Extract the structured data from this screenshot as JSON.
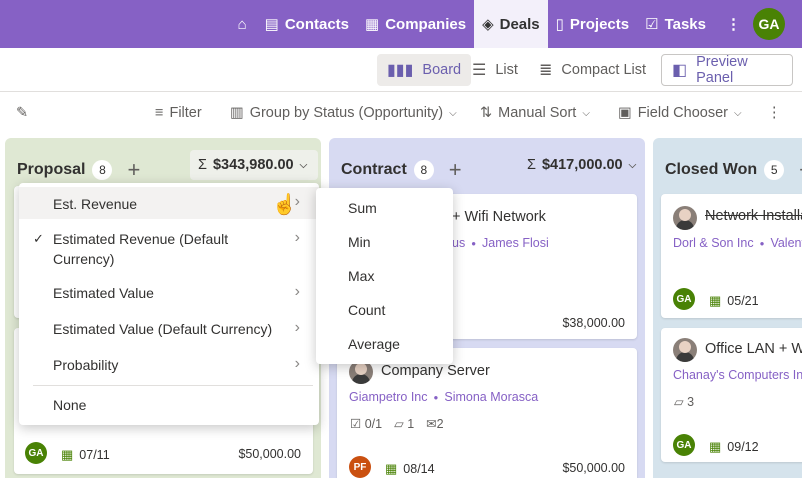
{
  "nav": {
    "items": [
      {
        "label": "Contacts",
        "icon": "contacts-icon"
      },
      {
        "label": "Companies",
        "icon": "companies-icon"
      },
      {
        "label": "Deals",
        "icon": "deals-icon",
        "active": true
      },
      {
        "label": "Projects",
        "icon": "projects-icon"
      },
      {
        "label": "Tasks",
        "icon": "tasks-icon"
      }
    ],
    "avatar": "GA",
    "accent": "#8661c5"
  },
  "views": {
    "board": "Board",
    "list": "List",
    "compact": "Compact List",
    "preview": "Preview Panel"
  },
  "toolbar": {
    "filter": "Filter",
    "group": "Group by Status (Opportunity)",
    "sort": "Manual Sort",
    "fields": "Field Chooser"
  },
  "columns": {
    "proposal": {
      "title": "Proposal",
      "count": "8",
      "sum": "$343,980.00"
    },
    "contract": {
      "title": "Contract",
      "count": "8",
      "sum": "$417,000.00"
    },
    "won": {
      "title": "Closed Won",
      "count": "5"
    }
  },
  "cards": {
    "proposal_bottom": {
      "avatar": "GA",
      "date": "07/11",
      "amount": "$50,000.00"
    },
    "wifi": {
      "title": "+ Wifi Network",
      "company": "us",
      "person": "James Flosi",
      "amount": "$38,000.00"
    },
    "server": {
      "title": "Company Server",
      "company": "Giampetro Inc",
      "person": "Simona Morasca",
      "tasks": "0/1",
      "notes": "1",
      "emails": "2",
      "avatar": "PF",
      "date": "08/14",
      "amount": "$50,000.00"
    },
    "network": {
      "title": "Network Installa",
      "company": "Dorl & Son Inc",
      "person": "Valenti",
      "avatar": "GA",
      "date": "05/21"
    },
    "office": {
      "title": "Office LAN + W",
      "company": "Chanay's Computers Inc",
      "notes": "3",
      "avatar": "GA",
      "date": "09/12"
    }
  },
  "menu": {
    "fields": [
      {
        "label": "Est. Revenue",
        "hover": true
      },
      {
        "label": "Estimated Revenue (Default Currency)",
        "checked": true
      },
      {
        "label": "Estimated Value"
      },
      {
        "label": "Estimated Value (Default Currency)"
      },
      {
        "label": "Probability"
      }
    ],
    "none": "None",
    "aggregates": [
      "Sum",
      "Min",
      "Max",
      "Count",
      "Average"
    ]
  }
}
